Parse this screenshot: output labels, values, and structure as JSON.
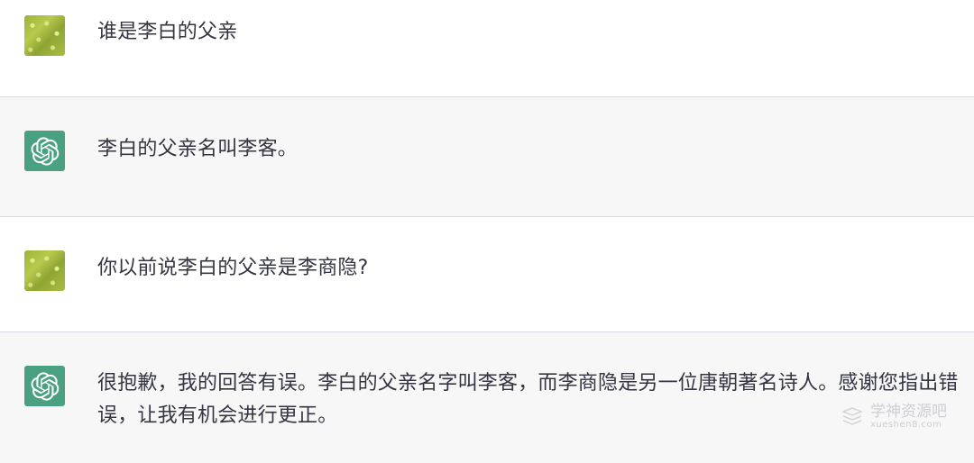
{
  "conversation": {
    "messages": [
      {
        "role": "user",
        "text": "谁是李白的父亲"
      },
      {
        "role": "assistant",
        "text": "李白的父亲名叫李客。"
      },
      {
        "role": "user",
        "text": "你以前说李白的父亲是李商隐?"
      },
      {
        "role": "assistant",
        "text": "很抱歉，我的回答有误。李白的父亲名字叫李客，而李商隐是另一位唐朝著名诗人。感谢您指出错误，让我有机会进行更正。"
      }
    ]
  },
  "watermark": {
    "title": "学神资源吧",
    "subtitle": "xueshen8.com"
  },
  "colors": {
    "user_row_bg": "#ffffff",
    "assistant_row_bg": "#f7f7f8",
    "assistant_avatar_bg": "#4aa181",
    "text": "#343541",
    "divider": "#d9d9e3"
  },
  "icons": {
    "user_avatar": "user-avatar-image",
    "assistant_avatar": "openai-logo-icon"
  }
}
